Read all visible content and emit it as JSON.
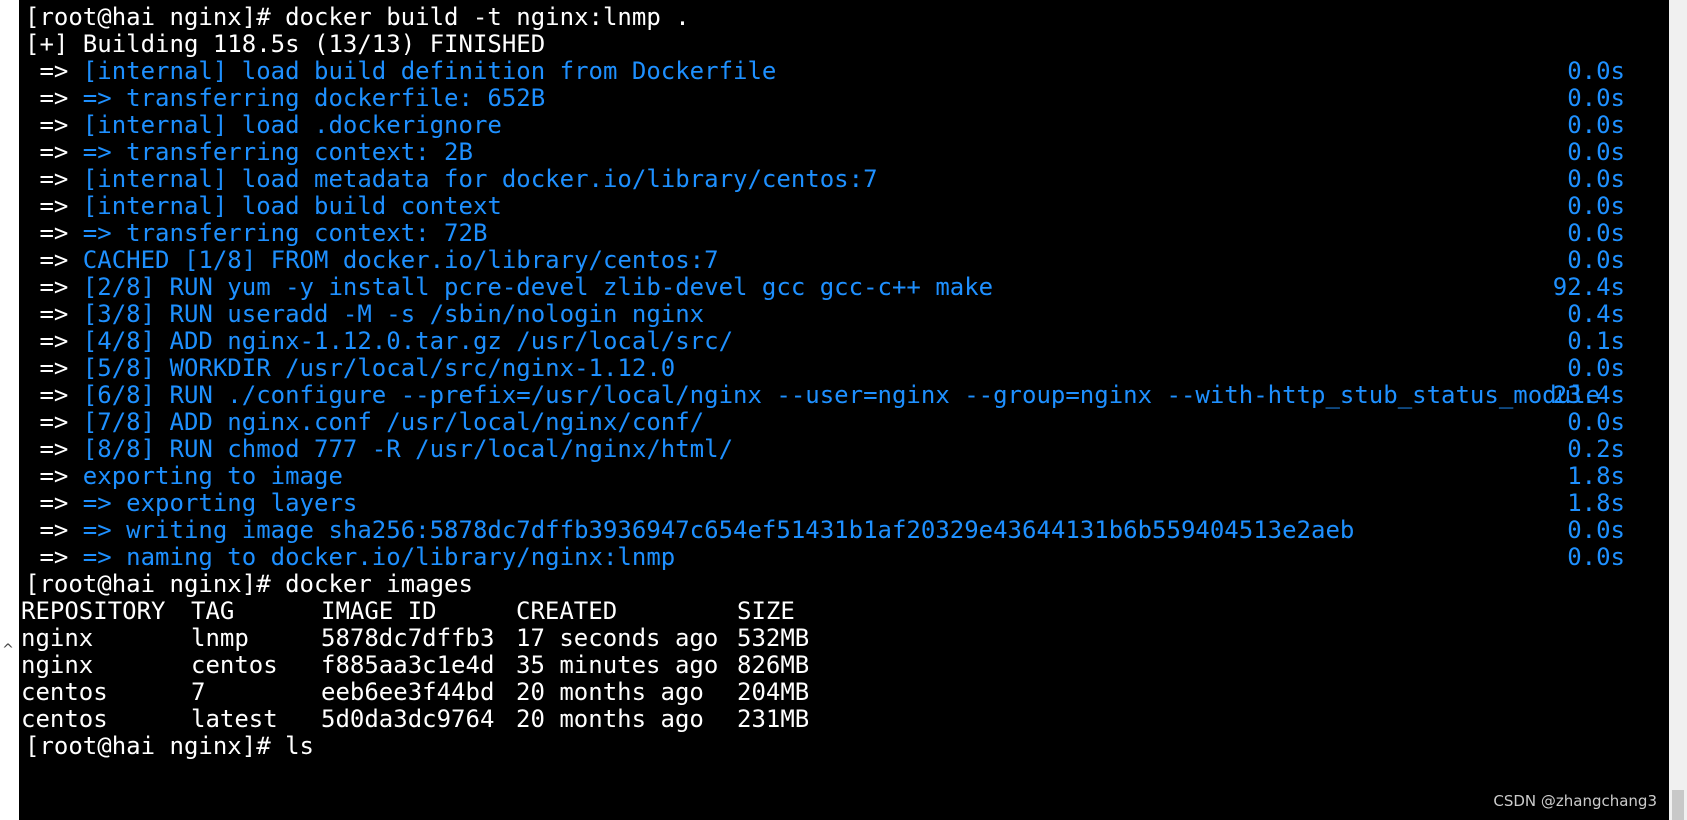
{
  "terminal": {
    "prompt": "[root@hai nginx]#",
    "commands": {
      "build": "docker build -t nginx:lnmp .",
      "images": "docker images",
      "ls": "ls"
    },
    "build_status": "Building 118.5s (13/13) FINISHED",
    "build_prefix": "[+]",
    "arrow": "=>",
    "steps": [
      {
        "text": "[internal] load build definition from Dockerfile",
        "duration": "0.0s"
      },
      {
        "text": "=> transferring dockerfile: 652B",
        "duration": "0.0s"
      },
      {
        "text": "[internal] load .dockerignore",
        "duration": "0.0s"
      },
      {
        "text": "=> transferring context: 2B",
        "duration": "0.0s"
      },
      {
        "text": "[internal] load metadata for docker.io/library/centos:7",
        "duration": "0.0s"
      },
      {
        "text": "[internal] load build context",
        "duration": "0.0s"
      },
      {
        "text": "=> transferring context: 72B",
        "duration": "0.0s"
      },
      {
        "text": "CACHED [1/8] FROM docker.io/library/centos:7",
        "duration": "0.0s"
      },
      {
        "text": "[2/8] RUN yum -y install pcre-devel zlib-devel gcc gcc-c++ make",
        "duration": "92.4s"
      },
      {
        "text": "[3/8] RUN useradd -M -s /sbin/nologin nginx",
        "duration": "0.4s"
      },
      {
        "text": "[4/8] ADD nginx-1.12.0.tar.gz /usr/local/src/",
        "duration": "0.1s"
      },
      {
        "text": "[5/8] WORKDIR /usr/local/src/nginx-1.12.0",
        "duration": "0.0s"
      },
      {
        "text": "[6/8] RUN ./configure --prefix=/usr/local/nginx --user=nginx --group=nginx --with-http_stub_status_module",
        "duration": "23.4s"
      },
      {
        "text": "[7/8] ADD nginx.conf /usr/local/nginx/conf/",
        "duration": "0.0s"
      },
      {
        "text": "[8/8] RUN chmod 777 -R /usr/local/nginx/html/",
        "duration": "0.2s"
      },
      {
        "text": "exporting to image",
        "duration": "1.8s"
      },
      {
        "text": "=> exporting layers",
        "duration": "1.8s"
      },
      {
        "text": "=> writing image sha256:5878dc7dffb3936947c654ef51431b1af20329e43644131b6b559404513e2aeb",
        "duration": "0.0s"
      },
      {
        "text": "=> naming to docker.io/library/nginx:lnmp",
        "duration": "0.0s"
      }
    ],
    "images_table": {
      "headers": [
        "REPOSITORY",
        "TAG",
        "IMAGE ID",
        "CREATED",
        "SIZE"
      ],
      "rows": [
        [
          "nginx",
          "lnmp",
          "5878dc7dffb3",
          "17 seconds ago",
          "532MB"
        ],
        [
          "nginx",
          "centos",
          "f885aa3c1e4d",
          "35 minutes ago",
          "826MB"
        ],
        [
          "centos",
          "7",
          "eeb6ee3f44bd",
          "20 months ago",
          "204MB"
        ],
        [
          "centos",
          "latest",
          "5d0da3dc9764",
          "20 months ago",
          "231MB"
        ]
      ]
    },
    "colors": {
      "background": "#000000",
      "text": "#ffffff",
      "build_step": "#1e90ff"
    }
  },
  "watermark": "CSDN @zhangchang3",
  "icons": {
    "scroll_up": "chevron-up-icon"
  }
}
